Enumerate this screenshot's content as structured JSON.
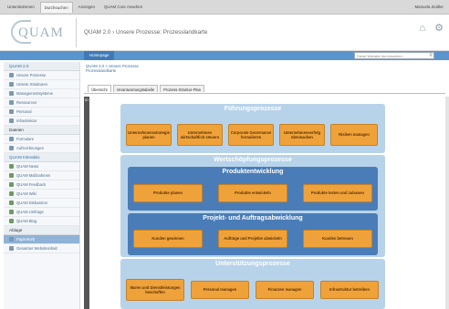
{
  "browser_tabs": [
    {
      "label": "Unterstützenen",
      "active": false
    },
    {
      "label": "Durchsuchen",
      "active": true
    },
    {
      "label": "Anzeigen",
      "active": false
    },
    {
      "label": "QUAM Core Ansehen",
      "active": false
    }
  ],
  "user_name": "Manuela Zeidler",
  "logo_text": "QUAM",
  "page_title": "QUAM 2.0 › Unsere Prozesse: Prozesslandkarte",
  "header_icons": [
    "tag-icon",
    "settings-icon"
  ],
  "nav": {
    "home_label": "Homepage"
  },
  "search": {
    "placeholder": "Diese Website durchsuchen..."
  },
  "sidebar": {
    "section1": {
      "title": "QUAM 2.0",
      "items": [
        "Unsere Prozesse",
        "Unsere Strukturen",
        "Managementsysteme",
        "Ressourcen",
        "Personal",
        "Infrastruktur"
      ]
    },
    "section2": {
      "title": "Dateien",
      "items": [
        "Formulare",
        "Aufzeichnungen"
      ]
    },
    "section3": {
      "title": "QUAM Interaktiv",
      "items": [
        "QUAM News",
        "QUAM Maßnahmen",
        "QUAM Feedback",
        "QUAM Wiki",
        "QUAM Diskussion",
        "QUAM Umfrage",
        "QUAM Blog"
      ]
    },
    "section4": {
      "title": "Ablage",
      "items": [
        "Papierkorb",
        "Gesamter Websiteinhalt"
      ]
    }
  },
  "breadcrumb": {
    "line1": "QUAM 2.0 > Unsere Prozesse",
    "line2": "Prozesslandkarte"
  },
  "page_tabs": [
    {
      "label": "Übersicht",
      "active": true
    },
    {
      "label": "Verantwortungstabelle",
      "active": false
    },
    {
      "label": "Prozess-Struktur-Plan",
      "active": false
    }
  ],
  "edit_label": "ID",
  "process_map": {
    "fuehrung": {
      "title": "Führungsprozesse",
      "boxes": [
        "Unternehmensstrategie planen",
        "Unternehmen wirtschaftlich steuern",
        "Corporate Governance formulieren",
        "Unternehmenserfolg überwachen",
        "Risiken managen"
      ]
    },
    "wertschoepfung": {
      "title": "Wertschöpfungsprozesse",
      "produktentwicklung": {
        "title": "Produktentwicklung",
        "boxes": [
          "Produkte planen",
          "Produkte entwickeln",
          "Produkte testen und zulassen"
        ]
      },
      "projektabwicklung": {
        "title": "Projekt- und Auftragsabwicklung",
        "boxes": [
          "Kunden gewinnen",
          "Aufträge und Projekte abwickeln",
          "Kunden betreuen"
        ]
      }
    },
    "unterstuetzung": {
      "title": "Unterstützungsprozesse",
      "boxes": [
        "Waren und Dienstleistungen beschaffen",
        "Personal managen",
        "Finanzen managen",
        "Infrastruktur betreiben"
      ]
    }
  },
  "colors": {
    "band": "#b7d3ea",
    "inner_band": "#4a7db7",
    "process_box": "#f0a23a",
    "nav_bar": "#5b95cd"
  }
}
